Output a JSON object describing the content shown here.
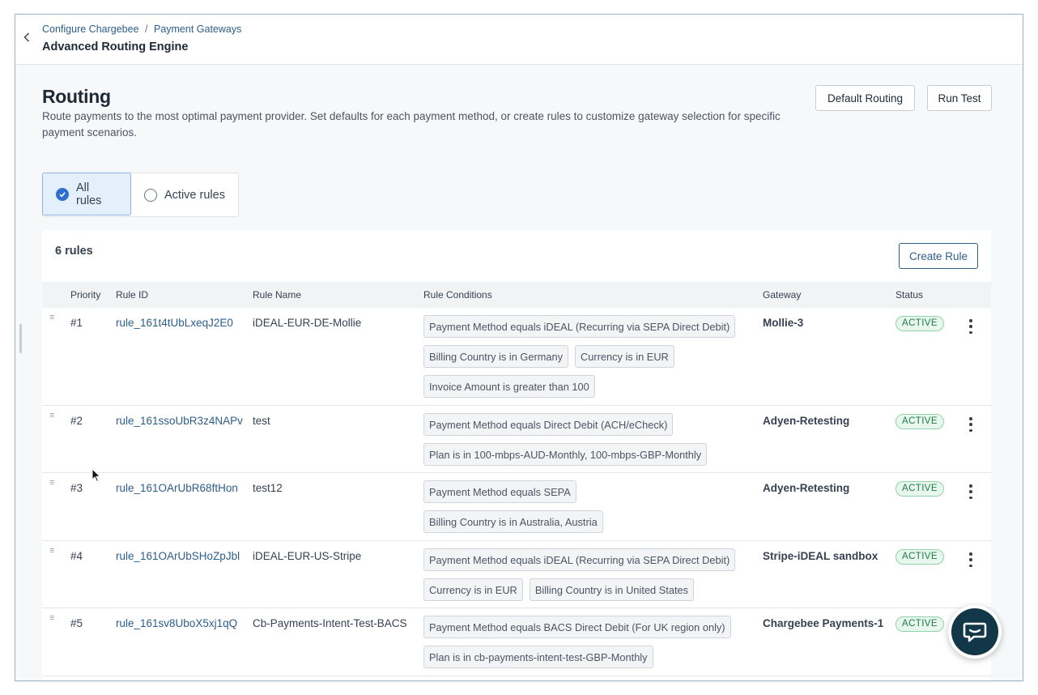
{
  "header": {
    "breadcrumb": [
      {
        "label": "Configure Chargebee"
      },
      {
        "label": "Payment Gateways"
      }
    ],
    "breadcrumb_separator": "/",
    "title": "Advanced Routing Engine"
  },
  "page": {
    "title": "Routing",
    "description": "Route payments to the most optimal payment provider. Set defaults for each payment method, or create rules to customize gateway selection for specific payment scenarios.",
    "default_routing_label": "Default Routing",
    "run_test_label": "Run Test"
  },
  "filter": {
    "all_rules_label": "All rules",
    "active_rules_label": "Active rules",
    "selected": "all"
  },
  "rules_card": {
    "count_label": "6 rules",
    "create_rule_label": "Create Rule",
    "columns": [
      "Priority",
      "Rule ID",
      "Rule Name",
      "Rule Conditions",
      "Gateway",
      "Status"
    ],
    "rows": [
      {
        "priority": "#1",
        "rule_id": "rule_161t4tUbLxeqJ2E0",
        "rule_name": "iDEAL-EUR-DE-Mollie",
        "conditions": [
          "Payment Method equals iDEAL (Recurring via SEPA Direct Debit)",
          "Billing Country is in Germany",
          "Currency is in EUR",
          "Invoice Amount is greater than 100"
        ],
        "gateway": "Mollie-3",
        "status": "ACTIVE"
      },
      {
        "priority": "#2",
        "rule_id": "rule_161ssoUbR3z4NAPv",
        "rule_name": "test",
        "conditions": [
          "Payment Method equals Direct Debit (ACH/eCheck)",
          "Plan is in 100-mbps-AUD-Monthly, 100-mbps-GBP-Monthly"
        ],
        "gateway": "Adyen-Retesting",
        "status": "ACTIVE"
      },
      {
        "priority": "#3",
        "rule_id": "rule_161OArUbR68ftHon",
        "rule_name": "test12",
        "conditions": [
          "Payment Method equals SEPA",
          "Billing Country is in Australia, Austria"
        ],
        "gateway": "Adyen-Retesting",
        "status": "ACTIVE"
      },
      {
        "priority": "#4",
        "rule_id": "rule_161OArUbSHoZpJbl",
        "rule_name": "iDEAL-EUR-US-Stripe",
        "conditions": [
          "Payment Method equals iDEAL (Recurring via SEPA Direct Debit)",
          "Currency is in EUR",
          "Billing Country is in United States"
        ],
        "gateway": "Stripe-iDEAL sandbox",
        "status": "ACTIVE"
      },
      {
        "priority": "#5",
        "rule_id": "rule_161sv8UboX5xj1qQ",
        "rule_name": "Cb-Payments-Intent-Test-BACS",
        "conditions": [
          "Payment Method equals BACS Direct Debit (For UK region only)",
          "Plan is in cb-payments-intent-test-GBP-Monthly"
        ],
        "gateway": "Chargebee Payments-1",
        "status": "ACTIVE"
      }
    ]
  },
  "icons": {
    "back": "chevron-left-icon",
    "drag": "drag-handle-icon",
    "more": "kebab-menu-icon",
    "chat": "chat-icon",
    "check": "check-icon"
  },
  "colors": {
    "link": "#2d5d8a",
    "selected_bg": "#e3effb",
    "radio_checked": "#2f6fd1",
    "status_active_bg": "#e8f7ed",
    "status_active_text": "#1f7a43",
    "chat_bg": "#123748"
  }
}
